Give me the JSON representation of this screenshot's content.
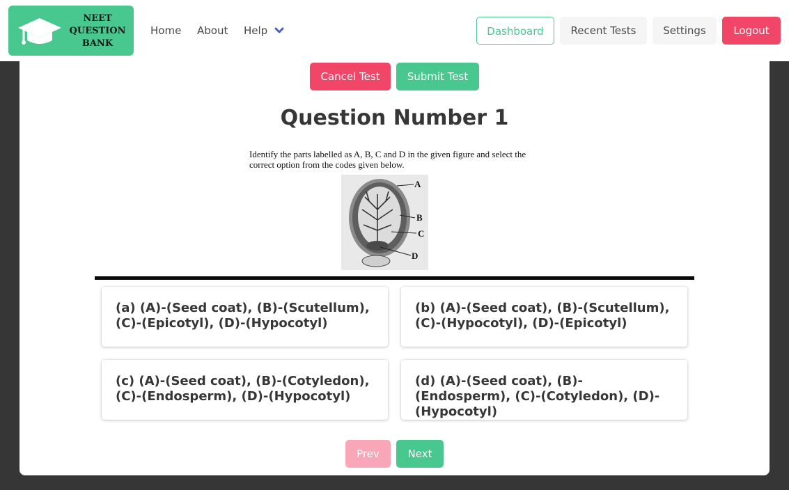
{
  "brand": {
    "logo_line1": "NEET",
    "logo_line2": "QUESTION",
    "logo_line3": "BANK",
    "logo_icon": "graduation-cap-icon",
    "accent_color": "#48c78e"
  },
  "nav": {
    "home": "Home",
    "about": "About",
    "help": "Help",
    "help_icon": "chevron-down-icon"
  },
  "actions": {
    "dashboard": "Dashboard",
    "recent_tests": "Recent Tests",
    "settings": "Settings",
    "logout": "Logout",
    "danger_color": "#f14668"
  },
  "test": {
    "cancel": "Cancel Test",
    "submit": "Submit Test"
  },
  "question": {
    "title": "Question Number 1",
    "text_line1": "Identify the parts labelled as A, B, C and D in the given figure and select the",
    "text_line2": "correct option from the codes given below.",
    "figure_labels": [
      "A",
      "B",
      "C",
      "D"
    ]
  },
  "options": [
    {
      "text": "(a) (A)-(Seed coat), (B)-(Scutellum), (C)-(Epicotyl), (D)-(Hypocotyl)"
    },
    {
      "text": "(b) (A)-(Seed coat), (B)-(Scutellum), (C)-(Hypocotyl), (D)-(Epicotyl)"
    },
    {
      "text": "(c) (A)-(Seed coat), (B)-(Cotyledon), (C)-(Endosperm), (D)-(Hypocotyl)"
    },
    {
      "text": "(d) (A)-(Seed coat), (B)-(Endosperm), (C)-(Cotyledon), (D)-(Hypocotyl)"
    }
  ],
  "pager": {
    "prev": "Prev",
    "next": "Next"
  }
}
